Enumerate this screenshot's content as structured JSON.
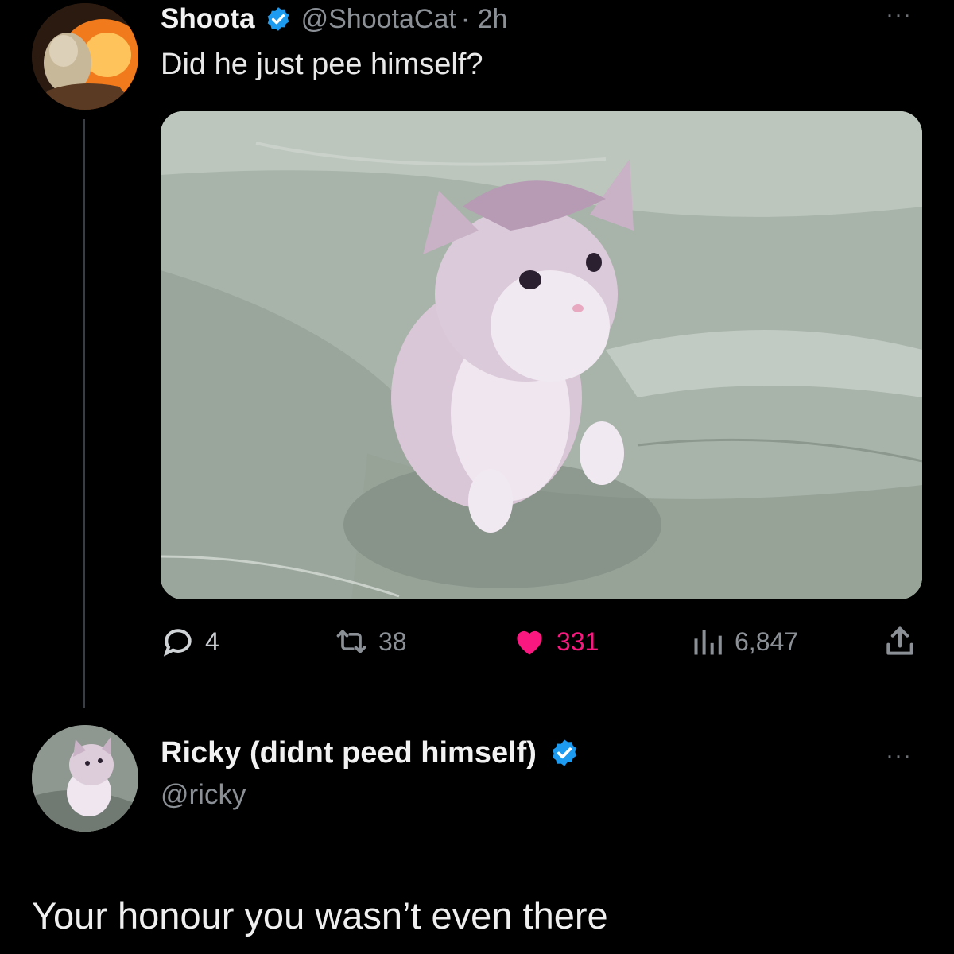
{
  "tweet": {
    "author_name": "Shoota",
    "handle": "@ShootaCat",
    "time": "· 2h",
    "text": "Did he just pee himself?",
    "more": "···",
    "media_description_icon": "kitten-photo",
    "stats": {
      "replies": "4",
      "retweets": "38",
      "likes": "331",
      "views": "6,847"
    },
    "like_color": "#f91880",
    "verified_color": "#1d9bf0"
  },
  "reply": {
    "author_name": "Ricky (didnt peed himself)",
    "handle": "@ricky",
    "more": "···",
    "text": "Your honour you wasn’t even there"
  }
}
